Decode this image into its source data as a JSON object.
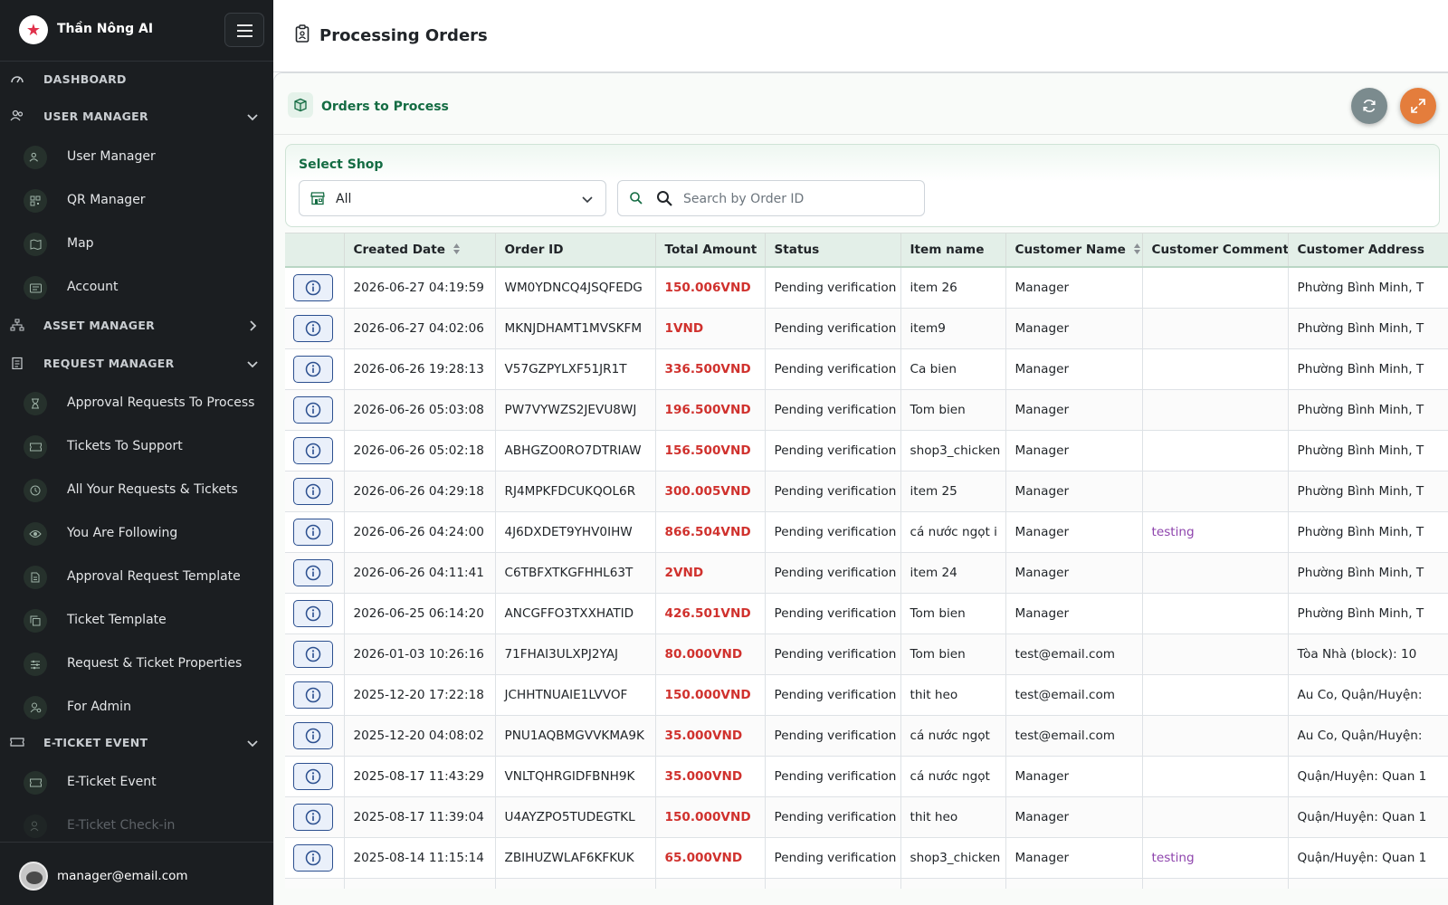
{
  "app": {
    "name": "Thần Nông AI"
  },
  "sidebar": {
    "sections": [
      {
        "id": "dashboard",
        "label": "DASHBOARD",
        "icon": "dashboard-icon"
      },
      {
        "id": "user-manager",
        "label": "USER MANAGER",
        "icon": "users-icon",
        "expanded": true,
        "items": [
          {
            "label": "User Manager",
            "icon": "users-icon"
          },
          {
            "label": "QR Manager",
            "icon": "qr-icon"
          },
          {
            "label": "Map",
            "icon": "map-icon"
          },
          {
            "label": "Account",
            "icon": "id-card-icon"
          }
        ]
      },
      {
        "id": "asset-manager",
        "label": "ASSET MANAGER",
        "icon": "sitemap-icon",
        "expanded": false
      },
      {
        "id": "request-manager",
        "label": "REQUEST MANAGER",
        "icon": "clipboard-icon",
        "expanded": true,
        "items": [
          {
            "label": "Approval Requests To Process",
            "icon": "hourglass-icon"
          },
          {
            "label": "Tickets To Support",
            "icon": "ticket-icon"
          },
          {
            "label": "All Your Requests & Tickets",
            "icon": "history-icon"
          },
          {
            "label": "You Are Following",
            "icon": "eye-icon"
          },
          {
            "label": "Approval Request Template",
            "icon": "document-icon"
          },
          {
            "label": "Ticket Template",
            "icon": "copy-icon"
          },
          {
            "label": "Request & Ticket Properties",
            "icon": "sliders-icon"
          },
          {
            "label": "For Admin",
            "icon": "user-gear-icon"
          }
        ]
      },
      {
        "id": "e-ticket-event",
        "label": "E-TICKET EVENT",
        "icon": "ticket-icon",
        "expanded": true,
        "items": [
          {
            "label": "E-Ticket Event",
            "icon": "ticket-icon"
          },
          {
            "label": "E-Ticket Check-in",
            "icon": "user-check-icon"
          }
        ]
      }
    ],
    "user_email": "manager@email.com"
  },
  "header": {
    "title": "Processing Orders"
  },
  "card": {
    "title": "Orders to Process"
  },
  "filters": {
    "shop_label": "Select Shop",
    "shop_value": "All",
    "search_placeholder": "Search by Order ID"
  },
  "table": {
    "columns": [
      "",
      "Created Date",
      "Order ID",
      "Total Amount",
      "Status",
      "Item name",
      "Customer Name",
      "Customer Comment",
      "Customer Address"
    ],
    "rows": [
      {
        "date": "2026-06-27 04:19:59",
        "order_id": "WM0YDNCQ4JSQFEDG",
        "amount": "150.006",
        "currency": "VND",
        "status": "Pending verification",
        "item": "item 26",
        "customer": "Manager",
        "comment": "",
        "address": "Phường Bình Minh, T"
      },
      {
        "date": "2026-06-27 04:02:06",
        "order_id": "MKNJDHAMT1MVSKFM",
        "amount": "1",
        "currency": "VND",
        "status": "Pending verification",
        "item": "item9",
        "customer": "Manager",
        "comment": "",
        "address": "Phường Bình Minh, T"
      },
      {
        "date": "2026-06-26 19:28:13",
        "order_id": "V57GZPYLXF51JR1T",
        "amount": "336.500",
        "currency": "VND",
        "status": "Pending verification",
        "item": "Ca bien",
        "customer": "Manager",
        "comment": "",
        "address": "Phường Bình Minh, T"
      },
      {
        "date": "2026-06-26 05:03:08",
        "order_id": "PW7VYWZS2JEVU8WJ",
        "amount": "196.500",
        "currency": "VND",
        "status": "Pending verification",
        "item": "Tom bien",
        "customer": "Manager",
        "comment": "",
        "address": "Phường Bình Minh, T"
      },
      {
        "date": "2026-06-26 05:02:18",
        "order_id": "ABHGZO0RO7DTRIAW",
        "amount": "156.500",
        "currency": "VND",
        "status": "Pending verification",
        "item": "shop3_chicken",
        "customer": "Manager",
        "comment": "",
        "address": "Phường Bình Minh, T"
      },
      {
        "date": "2026-06-26 04:29:18",
        "order_id": "RJ4MPKFDCUKQOL6R",
        "amount": "300.005",
        "currency": "VND",
        "status": "Pending verification",
        "item": "item 25",
        "customer": "Manager",
        "comment": "",
        "address": "Phường Bình Minh, T"
      },
      {
        "date": "2026-06-26 04:24:00",
        "order_id": "4J6DXDET9YHV0IHW",
        "amount": "866.504",
        "currency": "VND",
        "status": "Pending verification",
        "item": "cá nước ngọt i",
        "customer": "Manager",
        "comment": "testing",
        "address": "Phường Bình Minh, T"
      },
      {
        "date": "2026-06-26 04:11:41",
        "order_id": "C6TBFXTKGFHHL63T",
        "amount": "2",
        "currency": "VND",
        "status": "Pending verification",
        "item": "item 24",
        "customer": "Manager",
        "comment": "",
        "address": "Phường Bình Minh, T"
      },
      {
        "date": "2026-06-25 06:14:20",
        "order_id": "ANCGFFO3TXXHATID",
        "amount": "426.501",
        "currency": "VND",
        "status": "Pending verification",
        "item": "Tom bien",
        "customer": "Manager",
        "comment": "",
        "address": "Phường Bình Minh, T"
      },
      {
        "date": "2026-01-03 10:26:16",
        "order_id": "71FHAI3ULXPJ2YAJ",
        "amount": "80.000",
        "currency": "VND",
        "status": "Pending verification",
        "item": "Tom bien",
        "customer": "test@email.com",
        "comment": "",
        "address": "Tòa Nhà (block): 10"
      },
      {
        "date": "2025-12-20 17:22:18",
        "order_id": "JCHHTNUAIE1LVVOF",
        "amount": "150.000",
        "currency": "VND",
        "status": "Pending verification",
        "item": "thit heo",
        "customer": "test@email.com",
        "comment": "",
        "address": "Au Co, Quận/Huyện:"
      },
      {
        "date": "2025-12-20 04:08:02",
        "order_id": "PNU1AQBMGVVKMA9K",
        "amount": "35.000",
        "currency": "VND",
        "status": "Pending verification",
        "item": "cá nước ngọt",
        "customer": "test@email.com",
        "comment": "",
        "address": "Au Co, Quận/Huyện:"
      },
      {
        "date": "2025-08-17 11:43:29",
        "order_id": "VNLTQHRGIDFBNH9K",
        "amount": "35.000",
        "currency": "VND",
        "status": "Pending verification",
        "item": "cá nước ngọt",
        "customer": "Manager",
        "comment": "",
        "address": "Quận/Huyện: Quan 1"
      },
      {
        "date": "2025-08-17 11:39:04",
        "order_id": "U4AYZPO5TUDEGTKL",
        "amount": "150.000",
        "currency": "VND",
        "status": "Pending verification",
        "item": "thit heo",
        "customer": "Manager",
        "comment": "",
        "address": "Quận/Huyện: Quan 1"
      },
      {
        "date": "2025-08-14 11:15:14",
        "order_id": "ZBIHUZWLAF6KFKUK",
        "amount": "65.000",
        "currency": "VND",
        "status": "Pending verification",
        "item": "shop3_chicken",
        "customer": "Manager",
        "comment": "testing",
        "address": "Quận/Huyện: Quan 1"
      }
    ]
  },
  "colors": {
    "accent_green": "#146c43",
    "amount_red": "#d0312d",
    "comment_purple": "#8e44ad",
    "sidebar_bg": "#1b1e21"
  }
}
